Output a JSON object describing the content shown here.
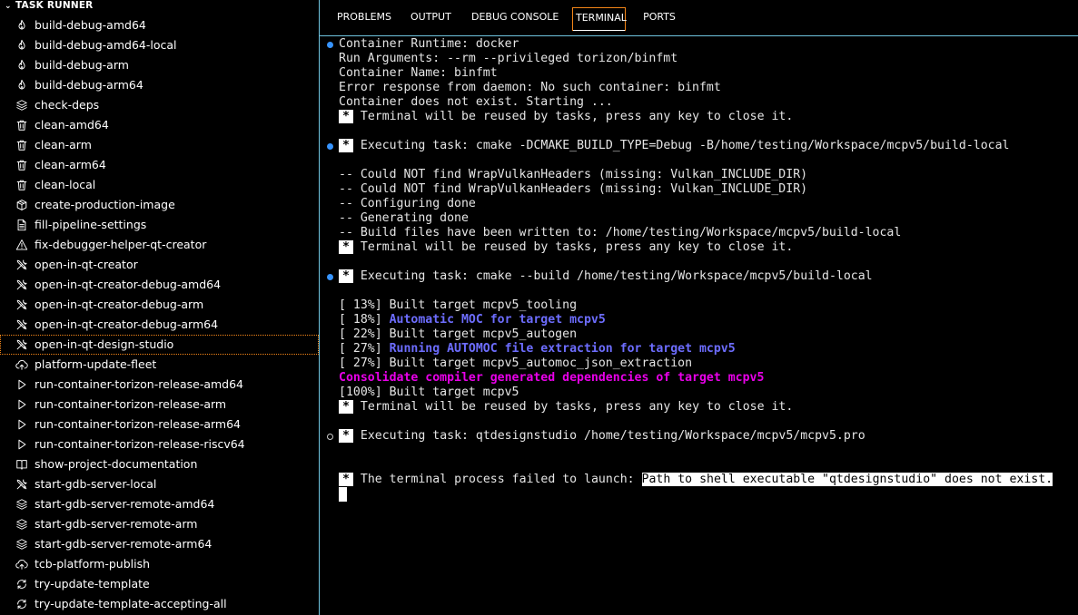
{
  "sidebar": {
    "header": "TASK RUNNER",
    "tasks": [
      {
        "label": "build-debug-amd64",
        "icon": "flame-icon"
      },
      {
        "label": "build-debug-amd64-local",
        "icon": "flame-icon"
      },
      {
        "label": "build-debug-arm",
        "icon": "flame-icon"
      },
      {
        "label": "build-debug-arm64",
        "icon": "flame-icon"
      },
      {
        "label": "check-deps",
        "icon": "layers-icon"
      },
      {
        "label": "clean-amd64",
        "icon": "trash-icon"
      },
      {
        "label": "clean-arm",
        "icon": "trash-icon"
      },
      {
        "label": "clean-arm64",
        "icon": "trash-icon"
      },
      {
        "label": "clean-local",
        "icon": "trash-icon"
      },
      {
        "label": "create-production-image",
        "icon": "package-icon"
      },
      {
        "label": "fill-pipeline-settings",
        "icon": "file-icon"
      },
      {
        "label": "fix-debugger-helper-qt-creator",
        "icon": "warning-icon"
      },
      {
        "label": "open-in-qt-creator",
        "icon": "tools-icon"
      },
      {
        "label": "open-in-qt-creator-debug-amd64",
        "icon": "tools-icon"
      },
      {
        "label": "open-in-qt-creator-debug-arm",
        "icon": "tools-icon"
      },
      {
        "label": "open-in-qt-creator-debug-arm64",
        "icon": "tools-icon"
      },
      {
        "label": "open-in-qt-design-studio",
        "icon": "tools-icon",
        "selected": true
      },
      {
        "label": "platform-update-fleet",
        "icon": "cloud-upload-icon"
      },
      {
        "label": "run-container-torizon-release-amd64",
        "icon": "play-icon"
      },
      {
        "label": "run-container-torizon-release-arm",
        "icon": "play-icon"
      },
      {
        "label": "run-container-torizon-release-arm64",
        "icon": "play-icon"
      },
      {
        "label": "run-container-torizon-release-riscv64",
        "icon": "play-icon"
      },
      {
        "label": "show-project-documentation",
        "icon": "book-icon"
      },
      {
        "label": "start-gdb-server-local",
        "icon": "tools-icon"
      },
      {
        "label": "start-gdb-server-remote-amd64",
        "icon": "layers-icon"
      },
      {
        "label": "start-gdb-server-remote-arm",
        "icon": "layers-icon"
      },
      {
        "label": "start-gdb-server-remote-arm64",
        "icon": "layers-icon"
      },
      {
        "label": "tcb-platform-publish",
        "icon": "cloud-upload-icon"
      },
      {
        "label": "try-update-template",
        "icon": "sync-icon"
      },
      {
        "label": "try-update-template-accepting-all",
        "icon": "sync-icon"
      }
    ]
  },
  "panel": {
    "tabs": [
      {
        "label": "PROBLEMS"
      },
      {
        "label": "OUTPUT"
      },
      {
        "label": "DEBUG CONSOLE"
      },
      {
        "label": "TERMINAL",
        "active": true
      },
      {
        "label": "PORTS"
      }
    ]
  },
  "terminal": {
    "lines": [
      {
        "row": 0,
        "deco": "filled",
        "segments": [
          {
            "text": "Container Runtime: docker"
          }
        ]
      },
      {
        "row": 1,
        "segments": [
          {
            "text": "Run Arguments: --rm --privileged torizon/binfmt"
          }
        ]
      },
      {
        "row": 2,
        "segments": [
          {
            "text": "Container Name: binfmt"
          }
        ]
      },
      {
        "row": 3,
        "segments": [
          {
            "text": "Error response from daemon: No such container: binfmt"
          }
        ]
      },
      {
        "row": 4,
        "segments": [
          {
            "text": "Container does not exist. Starting ..."
          }
        ]
      },
      {
        "row": 5,
        "segments": [
          {
            "text": "*",
            "style": "star"
          },
          {
            "text": " Terminal will be reused by tasks, press any key to close it."
          }
        ]
      },
      {
        "row": 7,
        "deco": "filled",
        "segments": [
          {
            "text": "*",
            "style": "star"
          },
          {
            "text": " Executing task: cmake -DCMAKE_BUILD_TYPE=Debug -B/home/testing/Workspace/mcpv5/build-local"
          }
        ]
      },
      {
        "row": 9,
        "segments": [
          {
            "text": "-- Could NOT find WrapVulkanHeaders (missing: Vulkan_INCLUDE_DIR)"
          }
        ]
      },
      {
        "row": 10,
        "segments": [
          {
            "text": "-- Could NOT find WrapVulkanHeaders (missing: Vulkan_INCLUDE_DIR)"
          }
        ]
      },
      {
        "row": 11,
        "segments": [
          {
            "text": "-- Configuring done"
          }
        ]
      },
      {
        "row": 12,
        "segments": [
          {
            "text": "-- Generating done"
          }
        ]
      },
      {
        "row": 13,
        "segments": [
          {
            "text": "-- Build files have been written to: /home/testing/Workspace/mcpv5/build-local"
          }
        ]
      },
      {
        "row": 14,
        "segments": [
          {
            "text": "*",
            "style": "star"
          },
          {
            "text": " Terminal will be reused by tasks, press any key to close it."
          }
        ]
      },
      {
        "row": 16,
        "deco": "filled",
        "segments": [
          {
            "text": "*",
            "style": "star"
          },
          {
            "text": " Executing task: cmake --build /home/testing/Workspace/mcpv5/build-local"
          }
        ]
      },
      {
        "row": 18,
        "segments": [
          {
            "text": "[ 13%] Built target mcpv5_tooling"
          }
        ]
      },
      {
        "row": 19,
        "segments": [
          {
            "text": "[ 18%] "
          },
          {
            "text": "Automatic MOC for target mcpv5",
            "style": "c-blue"
          }
        ]
      },
      {
        "row": 20,
        "segments": [
          {
            "text": "[ 22%] Built target mcpv5_autogen"
          }
        ]
      },
      {
        "row": 21,
        "segments": [
          {
            "text": "[ 27%] "
          },
          {
            "text": "Running AUTOMOC file extraction for target mcpv5",
            "style": "c-blue"
          }
        ]
      },
      {
        "row": 22,
        "segments": [
          {
            "text": "[ 27%] Built target mcpv5_automoc_json_extraction"
          }
        ]
      },
      {
        "row": 23,
        "segments": [
          {
            "text": "Consolidate compiler generated dependencies of target mcpv5",
            "style": "c-magenta"
          }
        ]
      },
      {
        "row": 24,
        "segments": [
          {
            "text": "[100%] Built target mcpv5"
          }
        ]
      },
      {
        "row": 25,
        "segments": [
          {
            "text": "*",
            "style": "star"
          },
          {
            "text": " Terminal will be reused by tasks, press any key to close it."
          }
        ]
      },
      {
        "row": 27,
        "deco": "hollow",
        "segments": [
          {
            "text": "*",
            "style": "star"
          },
          {
            "text": " Executing task: qtdesignstudio /home/testing/Workspace/mcpv5/mcpv5.pro"
          }
        ]
      },
      {
        "row": 30,
        "segments": [
          {
            "text": "*",
            "style": "star"
          },
          {
            "text": " The terminal process failed to launch: "
          },
          {
            "text": "Path to shell executable \"qtdesignstudio\" does not exist.",
            "style": "sel"
          }
        ]
      }
    ]
  },
  "colors": {
    "accent_border": "#6fc3df",
    "active_outline": "#f38518",
    "ansi_blue": "#6d6dff",
    "ansi_magenta": "#e900e9",
    "decoration_success": "#3794ff"
  }
}
